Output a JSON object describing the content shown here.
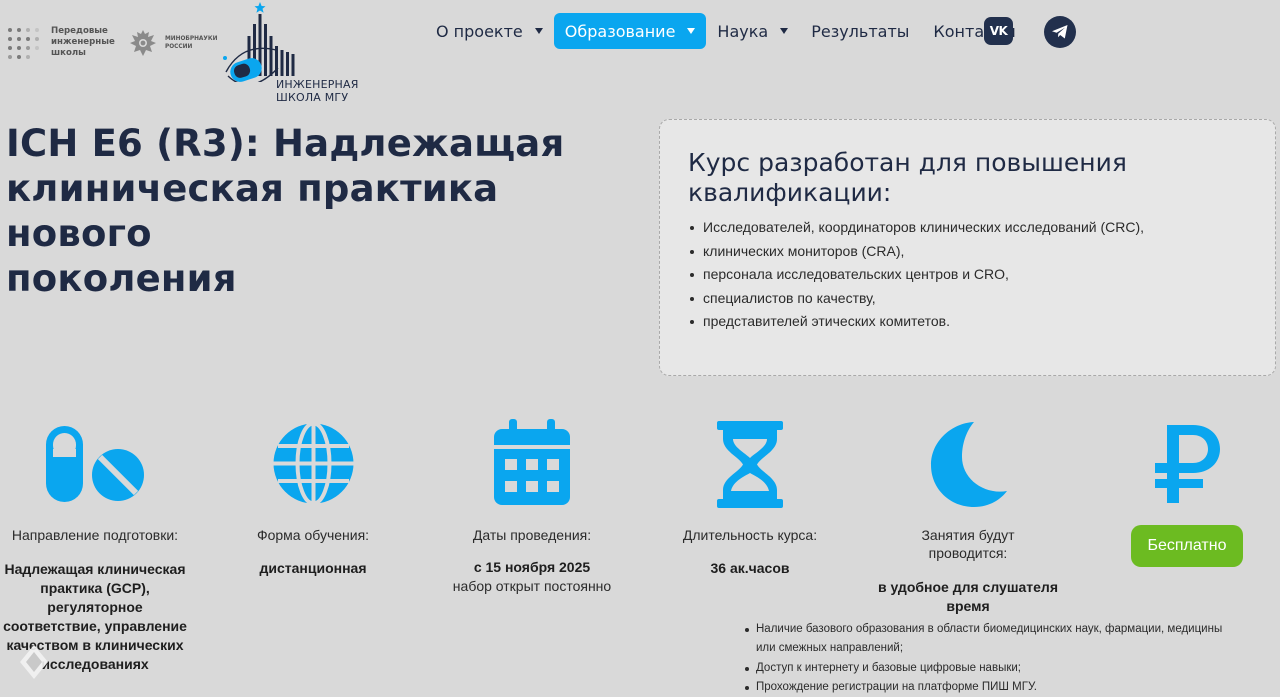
{
  "header": {
    "logo_pis": [
      "Передовые",
      "инженерные",
      "школы"
    ],
    "logo_minobr": [
      "МИНОБРНАУКИ",
      "РОССИИ"
    ],
    "logo_mgu": [
      "ИНЖЕНЕРНАЯ",
      "ШКОЛА МГУ"
    ],
    "nav": [
      {
        "label": "О проекте",
        "dropdown": true,
        "active": false
      },
      {
        "label": "Образование",
        "dropdown": true,
        "active": true
      },
      {
        "label": "Наука",
        "dropdown": true,
        "active": false
      },
      {
        "label": "Результаты",
        "dropdown": false,
        "active": false
      },
      {
        "label": "Контакты",
        "dropdown": false,
        "active": false
      }
    ],
    "social": {
      "vk": "vk-icon",
      "telegram": "telegram-icon",
      "vk_text": "VK"
    }
  },
  "hero": {
    "title_lines": [
      "ICH E6 (R3): Надлежащая",
      "клиническая практика нового",
      "поколения"
    ]
  },
  "audience": {
    "heading_lines": [
      "Курс разработан для повышения",
      "квалификации:"
    ],
    "items": [
      "Исследователей, координаторов клинических исследований (CRC),",
      "клинических мониторов (CRA),",
      "персонала исследовательских центров и CRO,",
      "специалистов по качеству,",
      "представителей этических комитетов."
    ]
  },
  "features": {
    "direction": {
      "label": "Направление подготовки:",
      "value_lines": [
        "Надлежащая клиническая",
        "практика (GCP),",
        "регуляторное",
        "соответствие, управление",
        "качеством в клинических",
        "исследованиях"
      ],
      "icon": "pills-icon"
    },
    "form": {
      "label": "Форма обучения:",
      "value": "дистанционная",
      "icon": "globe-icon"
    },
    "dates": {
      "label": "Даты проведения:",
      "value": "с 15 ноября 2025",
      "sub": "набор открыт постоянно",
      "icon": "calendar-icon"
    },
    "duration": {
      "label": "Длительность курса:",
      "value": "36 ак.часов",
      "icon": "hourglass-icon"
    },
    "schedule": {
      "label_lines": [
        "Занятия будут",
        "проводится:"
      ],
      "value_lines": [
        "в удобное для слушателя",
        "время"
      ],
      "icon": "moon-icon"
    },
    "price": {
      "button": "Бесплатно",
      "icon": "ruble-icon"
    }
  },
  "requirements": [
    "Наличие базового образования в области биомедицинских наук, фармации, медицины",
    "или смежных направлений;",
    "Доступ к интернету и базовые цифровые навыки;",
    "Прохождение регистрации на платформе ПИШ МГУ."
  ],
  "colors": {
    "accent": "#0aa6ef",
    "dark": "#1f2a44",
    "green": "#6cbb21",
    "background": "#d9d9d9"
  }
}
